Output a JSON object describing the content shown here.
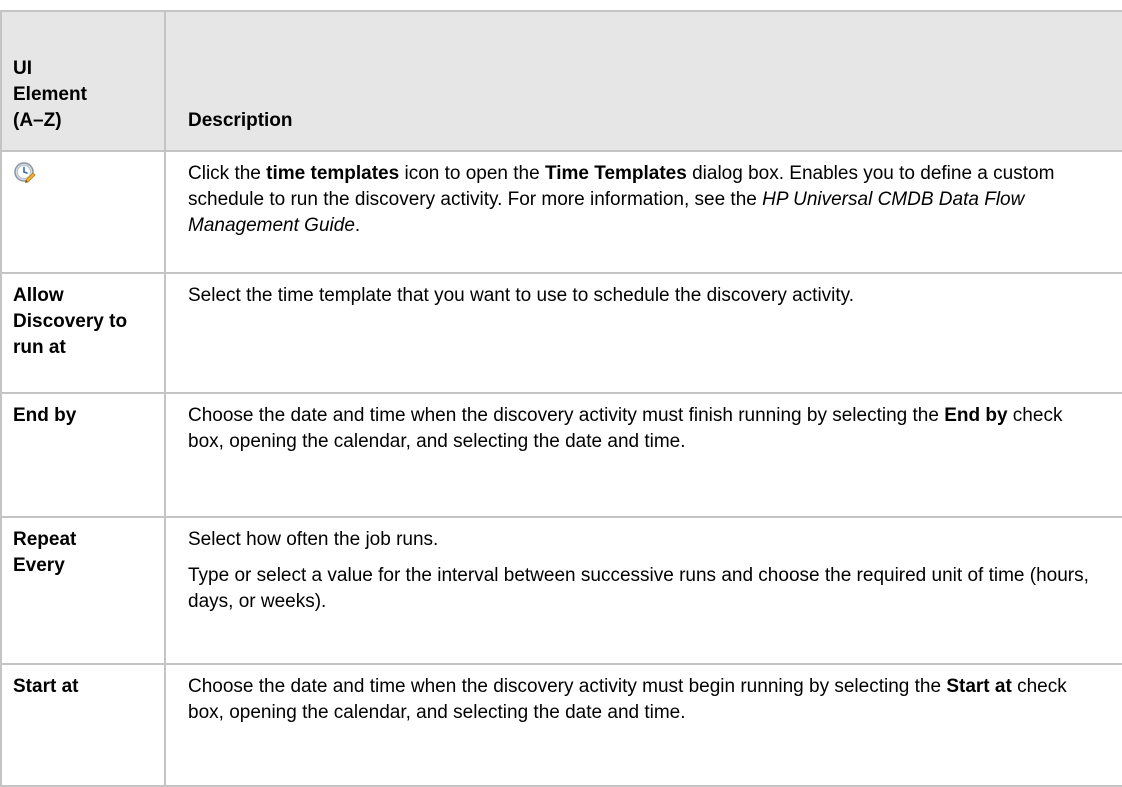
{
  "table": {
    "header": {
      "element_col": "UI Element (A–Z)",
      "description_col": "Description"
    },
    "rows": [
      {
        "element": "",
        "element_icon": "time-templates-icon",
        "description": [
          {
            "text": "Click the "
          },
          {
            "text": "time templates",
            "style": "bold"
          },
          {
            "text": " icon to open the "
          },
          {
            "text": "Time Templates",
            "style": "bold"
          },
          {
            "text": " dialog box. Enables you to define a custom schedule to run the discovery activity. For more information, see the "
          },
          {
            "text": "HP Universal CMDB Data Flow Management Guide",
            "style": "italic"
          },
          {
            "text": "."
          }
        ]
      },
      {
        "element": "Allow Discovery to run at",
        "description": [
          {
            "text": "Select the time template that you want to use to schedule the discovery activity."
          }
        ]
      },
      {
        "element": "End by",
        "description": [
          {
            "text": "Choose the date and time when the discovery activity must finish running by selecting the "
          },
          {
            "text": "End by",
            "style": "bold"
          },
          {
            "text": " check box, opening the calendar, and selecting the date and time."
          }
        ]
      },
      {
        "element": "Repeat Every",
        "description": [
          {
            "text": "Select how often the job runs."
          }
        ],
        "description_extra": "Type or select a value for the interval between successive runs and choose the required unit of time (hours, days, or weeks)."
      },
      {
        "element": "Start at",
        "description": [
          {
            "text": "Choose the date and time when the discovery activity must begin running by selecting the "
          },
          {
            "text": "Start at",
            "style": "bold"
          },
          {
            "text": " check box, opening the calendar, and selecting the date and time."
          }
        ]
      }
    ]
  }
}
